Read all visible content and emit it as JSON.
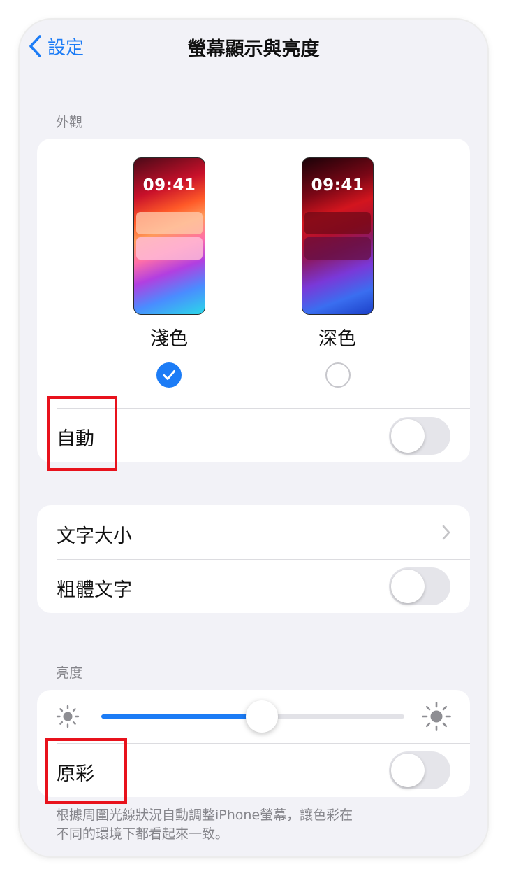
{
  "nav": {
    "back_label": "設定",
    "title": "螢幕顯示與亮度"
  },
  "appearance": {
    "section_label": "外觀",
    "light": {
      "label": "淺色",
      "time": "09:41",
      "selected": true
    },
    "dark": {
      "label": "深色",
      "time": "09:41",
      "selected": false
    },
    "auto": {
      "label": "自動",
      "on": false
    }
  },
  "text": {
    "text_size_label": "文字大小",
    "bold_text_label": "粗體文字",
    "bold_text_on": false
  },
  "brightness": {
    "section_label": "亮度",
    "level": 0.53,
    "true_tone": {
      "label": "原彩",
      "on": false
    },
    "footer_line1": "根據周圍光線狀況自動調整iPhone螢幕，讓色彩在",
    "footer_line2": "不同的環境下都看起來一致。"
  },
  "colors": {
    "accent": "#1c7cf6",
    "highlight": "#e8121c",
    "background": "#f2f2f7"
  }
}
